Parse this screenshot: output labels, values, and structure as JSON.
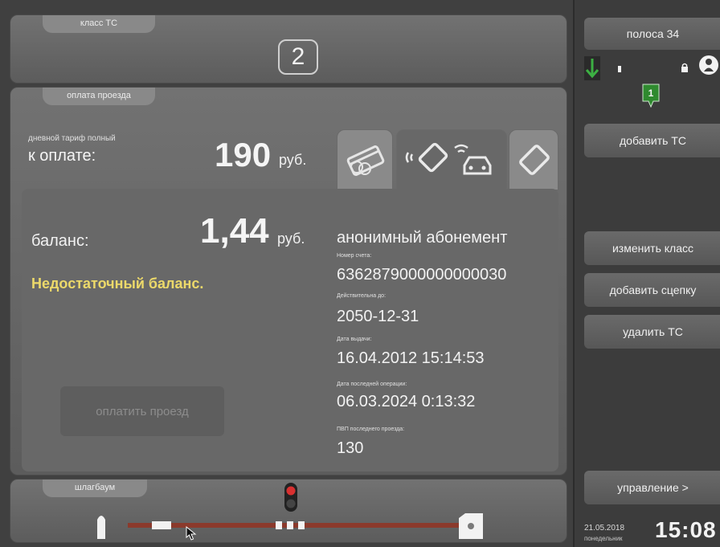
{
  "vehicle_class": {
    "tab_label": "класс ТС",
    "value": "2"
  },
  "payment": {
    "tab_label": "оплата проезда",
    "tariff_label": "дневной тариф полный",
    "to_pay_label": "к оплате:",
    "price": "190",
    "currency": "руб.",
    "methods": [
      "card-icon",
      "rfid-tag-car-icon",
      "tag-icon"
    ],
    "active_method": "rfid-tag-car-icon"
  },
  "balance": {
    "label": "баланс:",
    "amount": "1,44",
    "currency": "руб.",
    "message": "Недостаточный баланс."
  },
  "pay_button_label": "оплатить проезд",
  "subscription": {
    "title": "анонимный абонемент",
    "fields": [
      {
        "label": "Номер счета:",
        "value": "6362879000000000030"
      },
      {
        "label": "Действительна до:",
        "value": "2050-12-31"
      },
      {
        "label": "Дата выдачи:",
        "value": "16.04.2012 15:14:53"
      },
      {
        "label": "Дата последней операции:",
        "value": "06.03.2024 0:13:32"
      },
      {
        "label": "ПВП последнего проезда:",
        "value": "130"
      }
    ]
  },
  "barrier": {
    "tab_label": "шлагбаум"
  },
  "sidebar": {
    "lane_label": "полоса 34",
    "queue_count": "1",
    "add_vehicle": "добавить ТС",
    "change_class": "изменить класс",
    "add_trailer": "добавить сцепку",
    "remove_vehicle": "удалить ТС",
    "management": "управление >",
    "date": "21.05.2018",
    "weekday": "понедельник",
    "time": "15:08"
  },
  "colors": {
    "warning_text": "#ecd96a",
    "lane_green": "#2f8a2f",
    "barrier_red": "#8b3a2c",
    "signal_red": "#d83030"
  }
}
